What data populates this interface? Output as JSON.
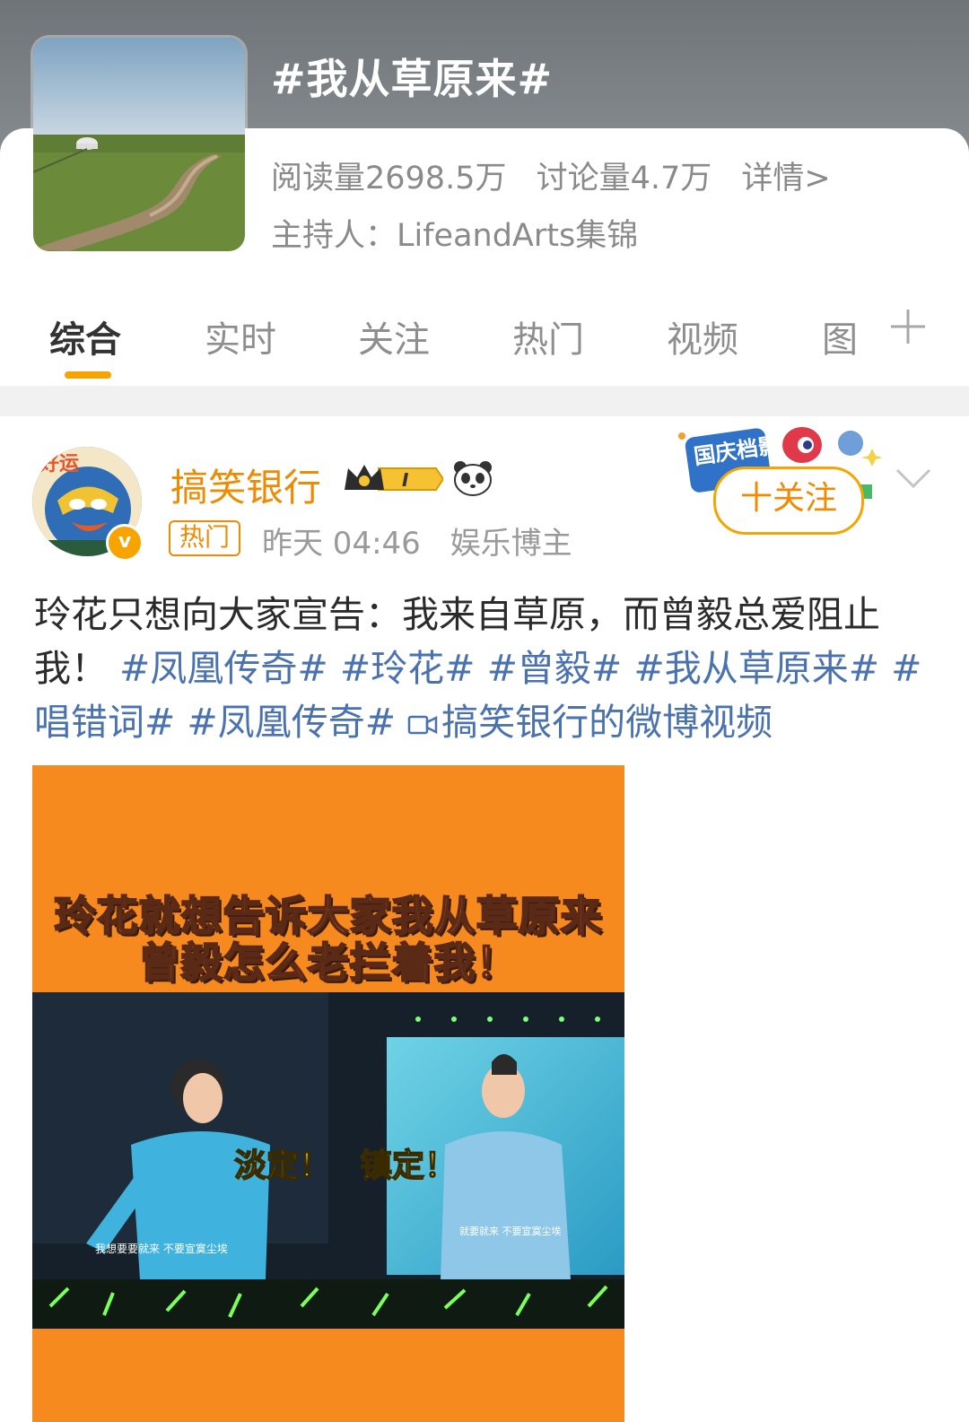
{
  "topic": {
    "title": "#我从草原来#",
    "reads": "阅读量2698.5万",
    "discussions": "讨论量4.7万",
    "details_link": "详情>",
    "host": "主持人：LifeandArts集锦"
  },
  "tabs": [
    {
      "label": "综合",
      "active": true
    },
    {
      "label": "实时",
      "active": false
    },
    {
      "label": "关注",
      "active": false
    },
    {
      "label": "热门",
      "active": false
    },
    {
      "label": "视频",
      "active": false
    },
    {
      "label": "图",
      "active": false
    }
  ],
  "tab_add_icon": "plus-icon",
  "post": {
    "author": "搞笑银行",
    "avatar_caption": "好运",
    "verified_icon": "v",
    "level_badge": "I",
    "hot_tag": "热门",
    "time": "昨天 04:46",
    "role": "娱乐博主",
    "follow_label": "十关注",
    "promo_label": "国庆档影评",
    "text_plain": "玲花只想向大家宣告：我来自草原，而曾毅总爱阻止我！",
    "hashtags": [
      "#凤凰传奇#",
      "#玲花#",
      "#曾毅#",
      "#我从草原来#",
      "#唱错词#",
      "#凤凰传奇#"
    ],
    "video_link": "搞笑银行的微博视频",
    "video": {
      "caption_line1": "玲花就想告诉大家我从草原来",
      "caption_line2": "曾毅怎么老拦着我！",
      "stage_text_left": "淡定！",
      "stage_text_right": "镇定！",
      "subtitle_left": "我想要要就来  不要宣寞尘埃",
      "subtitle_right": "就要就来  不要宣寞尘埃"
    }
  },
  "colors": {
    "accent": "#f7a400",
    "author": "#f08a00",
    "hashtag": "#4a72b0",
    "video_bg": "#f68a1e"
  }
}
